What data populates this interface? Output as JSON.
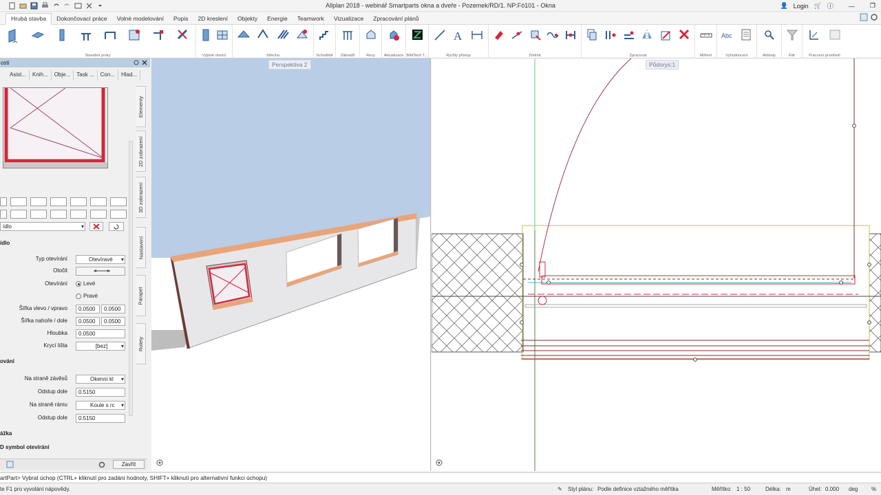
{
  "window": {
    "title": "Allplan 2018 - webinář Smartparts okna a dveře - Pozemek/RD/1. NP:Fó101 - Okna",
    "login": "Login"
  },
  "tabs": [
    "Hrubá stavba",
    "Dokončovací práce",
    "Volné modelování",
    "Popis",
    "2D kreslení",
    "Objekty",
    "Energie",
    "Teamwork",
    "Vizualizace",
    "Zpracování plánů"
  ],
  "ribbon_groups": [
    "Stavební prvky",
    "Výplně otvorů",
    "Střecha",
    "Schodiště",
    "Zábradlí",
    "Řezy",
    "Aktualizace",
    "BIMTech T...",
    "Rychlý přístup",
    "Změnit",
    "Zpracovat",
    "Měření",
    "Vyhodnocení",
    "Atributy",
    "Filtr",
    "Pracovní prostředí"
  ],
  "panel": {
    "title": "osti",
    "tabs": [
      "Asist...",
      "Knih...",
      "Obje...",
      "Task ...",
      "Con...",
      "Hlad..."
    ],
    "vtabs": [
      "Elementy",
      "2D zobrazení",
      "3D zobrazení",
      "Nastavení",
      "Parapet",
      "Rolety"
    ],
    "combo_value": "ídlo",
    "section1": "ídlo",
    "fields": {
      "typ_label": "Typ otevírání",
      "typ_value": "Otevíravé",
      "otocit_label": "Otočit",
      "oteviraní_label": "Otevírání",
      "leve": "Levé",
      "prave": "Pravé",
      "sirka_lp_label": "Šířka vlevo / vpravo",
      "sirka_l": "0.0500",
      "sirka_p": "0.0500",
      "sirka_hd_label": "Šířka nahoře / dole",
      "sirka_h": "0.0500",
      "sirka_d": "0.0500",
      "hloubka_label": "Hloubka",
      "hloubka_value": "0.0500",
      "kryci_label": "Krycí lišta",
      "kryci_value": "[bez]"
    },
    "section2": "ování",
    "fields2": {
      "zaves_label": "Na straně závěsů",
      "zaves_value": "Okenní kl",
      "odstup1_label": "Odstup dole",
      "odstup1_value": "0.5150",
      "ram_label": "Na straně rámu",
      "ram_value": "Koule s rc",
      "odstup2_label": "Odstup dole",
      "odstup2_value": "0.5150"
    },
    "section3": "ážka",
    "section4": "D symbol otevírání",
    "close": "Zavřít"
  },
  "viewports": {
    "left_label": "Perspektiva 2",
    "right_label": "Půdorys:1"
  },
  "command_line": "artPart> Vybrat úchop (CTRL+ kliknutí pro zadání hodnoty, SHIFT+ kliknutí pro alternativní funkci úchopu)",
  "status": {
    "help": "te F1 pro vyvolání nápovědy.",
    "style_label": "Styl plánu:",
    "style_value": "Podle definice vztažného měřítka",
    "scale_label": "Měřítko:",
    "scale_value": "1 : 50",
    "length_label": "Délka:",
    "length_unit": "m",
    "angle_label": "Úhel:",
    "angle_value": "0.000",
    "angle_unit": "deg",
    "percent": "%"
  },
  "colors": {
    "accent_tab": "#ffffff",
    "panel_header": "#b9cde3",
    "window_red": "#d6263a",
    "sky": "#b9cde6"
  }
}
